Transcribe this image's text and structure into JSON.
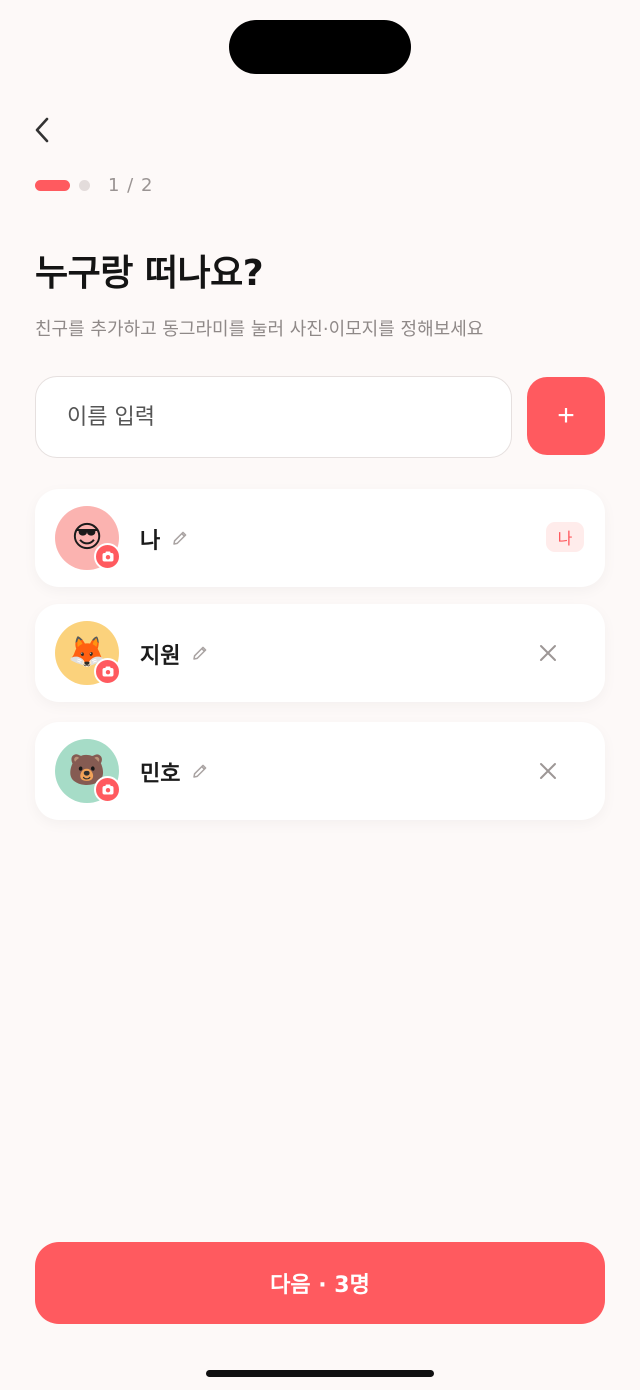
{
  "progress": {
    "step_text": "1 / 2",
    "current": 1,
    "total": 2
  },
  "title": "누구랑 떠나요?",
  "subtitle": "친구를 추가하고 동그라미를 눌러 사진·이모지를 정해보세요",
  "name_input": {
    "placeholder": "이름 입력",
    "value": ""
  },
  "add_button_label": "+",
  "members": [
    {
      "name": "나",
      "emoji": "😎",
      "avatar_color": "#fbb3b0",
      "badge": "나",
      "removable": false
    },
    {
      "name": "지원",
      "emoji": "🦊",
      "avatar_color": "#fbd27c",
      "removable": true
    },
    {
      "name": "민호",
      "emoji": "🐻",
      "avatar_color": "#a6dcc7",
      "removable": true
    }
  ],
  "next_button_label": "다음 · 3명",
  "colors": {
    "accent": "#ff5a5f",
    "background": "#fdf9f8"
  },
  "icons": [
    "back-arrow-icon",
    "pencil-icon",
    "camera-icon",
    "close-icon"
  ]
}
